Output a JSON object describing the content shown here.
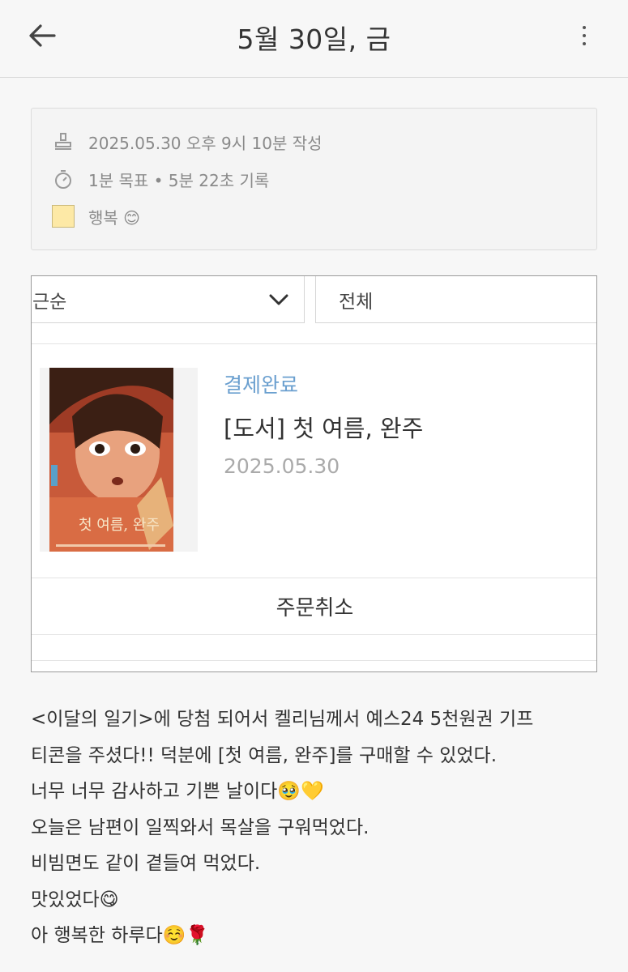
{
  "header": {
    "title": "5월 30일, 금",
    "back_icon": "arrow-left-icon",
    "more_icon": "more-vertical-icon"
  },
  "meta": {
    "written": "2025.05.30 오후 9시 10분 작성",
    "time_record": "1분 목표 • 5분 22초 기록",
    "mood": "행복 😊",
    "mood_color": "#fde9a6"
  },
  "order": {
    "sort_value": "근순",
    "filter_value": "전체",
    "status": "결제완료",
    "status_color": "#6a9fcf",
    "title": "[도서] 첫 여름, 완주",
    "date": "2025.05.30",
    "cancel_label": "주문취소",
    "cover": {
      "title_text": "첫 여름, 완주"
    }
  },
  "diary": {
    "lines": [
      "<이달의 일기>에 당첨 되어서 켈리님께서 예스24 5천원권 기프",
      "티콘을 주셨다!! 덕분에 [첫 여름, 완주]를 구매할 수 있었다.",
      "너무 너무 감사하고 기쁜 날이다🥹💛",
      "오늘은 남편이 일찍와서 목살을 구워먹었다.",
      "비빔면도 같이 곁들여 먹었다.",
      "맛있었다😋",
      "아 행복한 하루다☺️🌹"
    ]
  }
}
